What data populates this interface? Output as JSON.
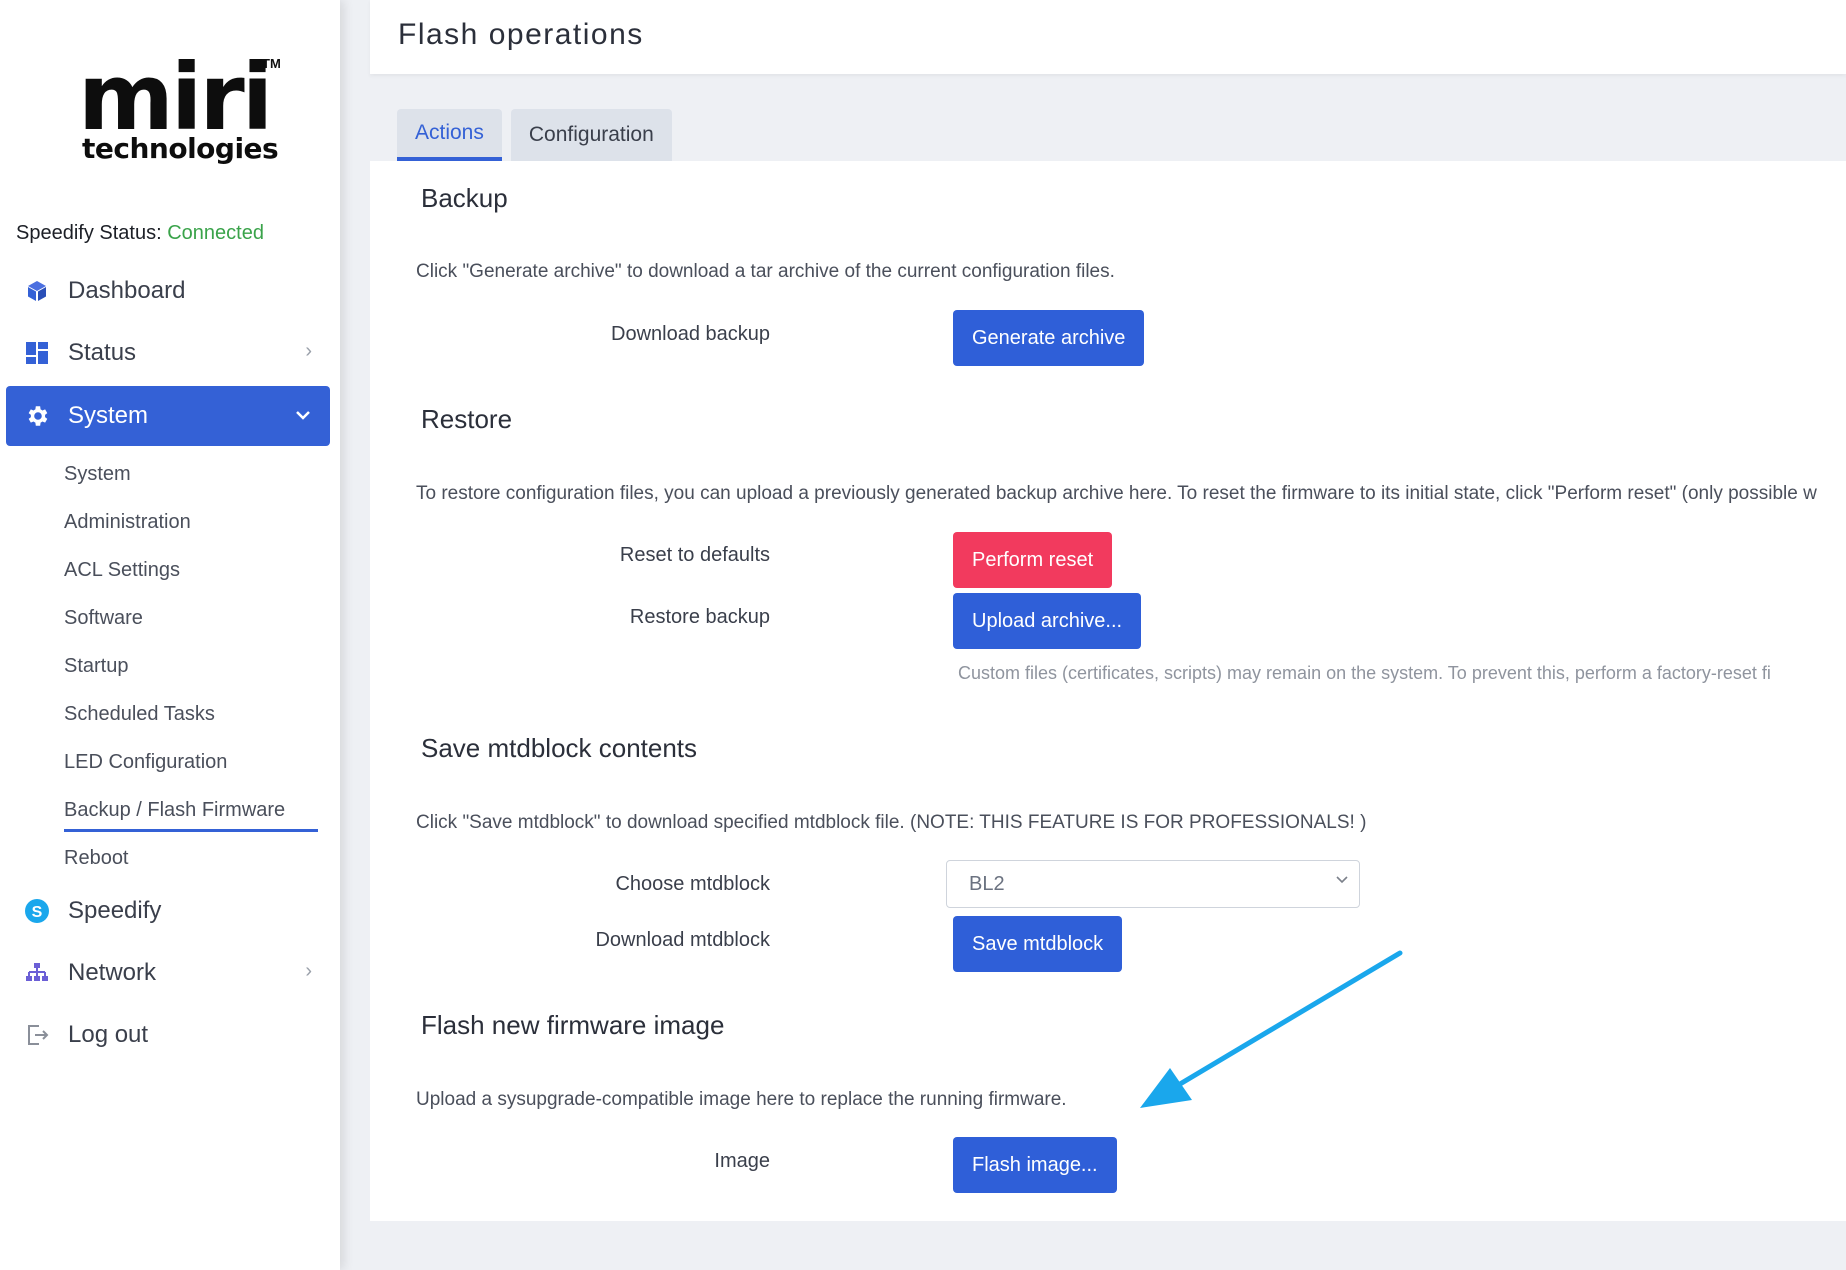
{
  "brand": {
    "logo_word": "miri",
    "tm": "TM",
    "logo_sub": "technologies"
  },
  "speedify_status": {
    "label": "Speedify Status:",
    "value": "Connected"
  },
  "nav": {
    "dashboard": "Dashboard",
    "status": "Status",
    "system": "System",
    "speedify": "Speedify",
    "network": "Network",
    "logout": "Log out"
  },
  "subnav": [
    "System",
    "Administration",
    "ACL Settings",
    "Software",
    "Startup",
    "Scheduled Tasks",
    "LED Configuration",
    "Backup / Flash Firmware",
    "Reboot"
  ],
  "header": {
    "title": "Flash operations"
  },
  "tabs": [
    "Actions",
    "Configuration"
  ],
  "backup": {
    "title": "Backup",
    "desc": "Click \"Generate archive\" to download a tar archive of the current configuration files.",
    "download_label": "Download backup",
    "generate_btn": "Generate archive"
  },
  "restore": {
    "title": "Restore",
    "desc": "To restore configuration files, you can upload a previously generated backup archive here. To reset the firmware to its initial state, click \"Perform reset\" (only possible w",
    "reset_label": "Reset to defaults",
    "reset_btn": "Perform reset",
    "restore_label": "Restore backup",
    "upload_btn": "Upload archive...",
    "hint": "Custom files (certificates, scripts) may remain on the system. To prevent this, perform a factory-reset fi"
  },
  "mtd": {
    "title": "Save mtdblock contents",
    "desc": "Click \"Save mtdblock\" to download specified mtdblock file. (NOTE: THIS FEATURE IS FOR PROFESSIONALS! )",
    "choose_label": "Choose mtdblock",
    "selected": "BL2",
    "download_label": "Download mtdblock",
    "save_btn": "Save mtdblock"
  },
  "flash": {
    "title": "Flash new firmware image",
    "desc": "Upload a sysupgrade-compatible image here to replace the running firmware.",
    "image_label": "Image",
    "flash_btn": "Flash image..."
  },
  "colors": {
    "accent": "#3461d6",
    "danger": "#f23a5e",
    "connected": "#3aa34a",
    "annotation_arrow": "#1aa7ec"
  }
}
